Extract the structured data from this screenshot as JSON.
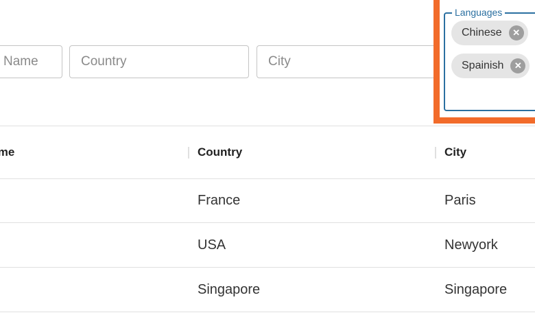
{
  "filters": {
    "name_placeholder": "Name",
    "country_placeholder": "Country",
    "city_placeholder": "City"
  },
  "languages": {
    "label": "Languages",
    "chips": [
      "Chinese",
      "Spainish"
    ],
    "remove_glyph": "✕"
  },
  "table": {
    "columns": [
      "Name",
      "Country",
      "City"
    ],
    "rows": [
      {
        "name": "",
        "country": "France",
        "city": "Paris"
      },
      {
        "name": "",
        "country": "USA",
        "city": "Newyork"
      },
      {
        "name": "",
        "country": "Singapore",
        "city": "Singapore"
      }
    ]
  },
  "colors": {
    "highlight": "#f26b2a",
    "focus": "#2a6fa0"
  }
}
